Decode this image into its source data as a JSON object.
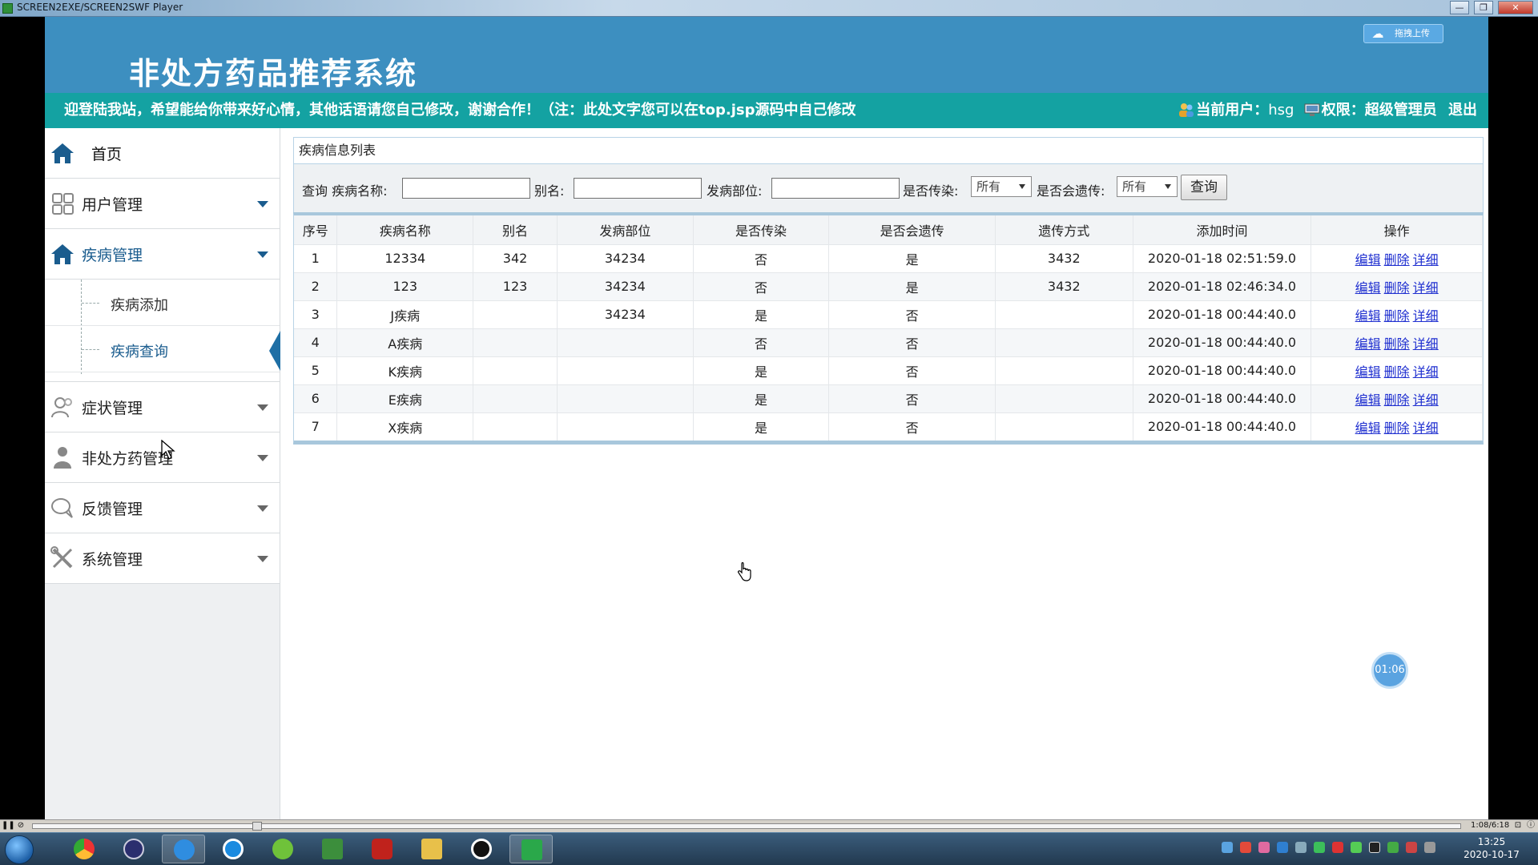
{
  "window": {
    "title": "SCREEN2EXE/SCREEN2SWF Player",
    "minimize": "—",
    "restore": "❐",
    "close": "✕"
  },
  "header": {
    "site_title": "非处方药品推荐系统",
    "upload_button": "拖拽上传",
    "notice_text": "迎登陆我站，希望能给你带来好心情，其他话语请您自己修改，谢谢合作！（注：此处文字您可以在top.jsp源码中自己修改",
    "current_user_label": "当前用户：",
    "current_user": "hsg",
    "role_label": "权限：",
    "role": "超级管理员",
    "logout": "退出"
  },
  "sidebar": {
    "home": "首页",
    "items": [
      {
        "label": "用户管理",
        "icon": "grid-icon"
      },
      {
        "label": "疾病管理",
        "icon": "house-icon"
      },
      {
        "label": "症状管理",
        "icon": "users-icon"
      },
      {
        "label": "非处方药管理",
        "icon": "person-icon"
      },
      {
        "label": "反馈管理",
        "icon": "chat-icon"
      },
      {
        "label": "系统管理",
        "icon": "tools-icon"
      }
    ],
    "disease_sub": [
      "疾病添加",
      "疾病查询"
    ]
  },
  "panel": {
    "title": "疾病信息列表",
    "search": {
      "label_query": "查询 疾病名称:",
      "label_alias": "别名:",
      "label_site": "发病部位:",
      "label_contagious": "是否传染:",
      "contagious_value": "所有",
      "label_hereditary": "是否会遗传:",
      "hereditary_value": "所有",
      "button": "查询"
    },
    "table": {
      "headers": [
        "序号",
        "疾病名称",
        "别名",
        "发病部位",
        "是否传染",
        "是否会遗传",
        "遗传方式",
        "添加时间",
        "操作"
      ],
      "rows": [
        [
          "1",
          "12334",
          "342",
          "34234",
          "否",
          "是",
          "3432",
          "2020-01-18 02:51:59.0"
        ],
        [
          "2",
          "123",
          "123",
          "34234",
          "否",
          "是",
          "3432",
          "2020-01-18 02:46:34.0"
        ],
        [
          "3",
          "J疾病",
          "",
          "34234",
          "是",
          "否",
          "",
          "2020-01-18 00:44:40.0"
        ],
        [
          "4",
          "A疾病",
          "",
          "",
          "否",
          "否",
          "",
          "2020-01-18 00:44:40.0"
        ],
        [
          "5",
          "K疾病",
          "",
          "",
          "是",
          "否",
          "",
          "2020-01-18 00:44:40.0"
        ],
        [
          "6",
          "E疾病",
          "",
          "",
          "是",
          "否",
          "",
          "2020-01-18 00:44:40.0"
        ],
        [
          "7",
          "X疾病",
          "",
          "",
          "是",
          "否",
          "",
          "2020-01-18 00:44:40.0"
        ]
      ],
      "ops": [
        "编辑",
        "删除",
        "详细"
      ]
    }
  },
  "timer": "01:06",
  "player": {
    "time": "1:08/6:18",
    "progress": 0.155
  },
  "taskbar": {
    "time": "13:25",
    "date": "2020-10-17"
  },
  "colors": {
    "banner": "#3d8fc0",
    "notice_bar": "#14a2a2",
    "accent": "#1a5c8e",
    "link": "#1f2fd0"
  }
}
